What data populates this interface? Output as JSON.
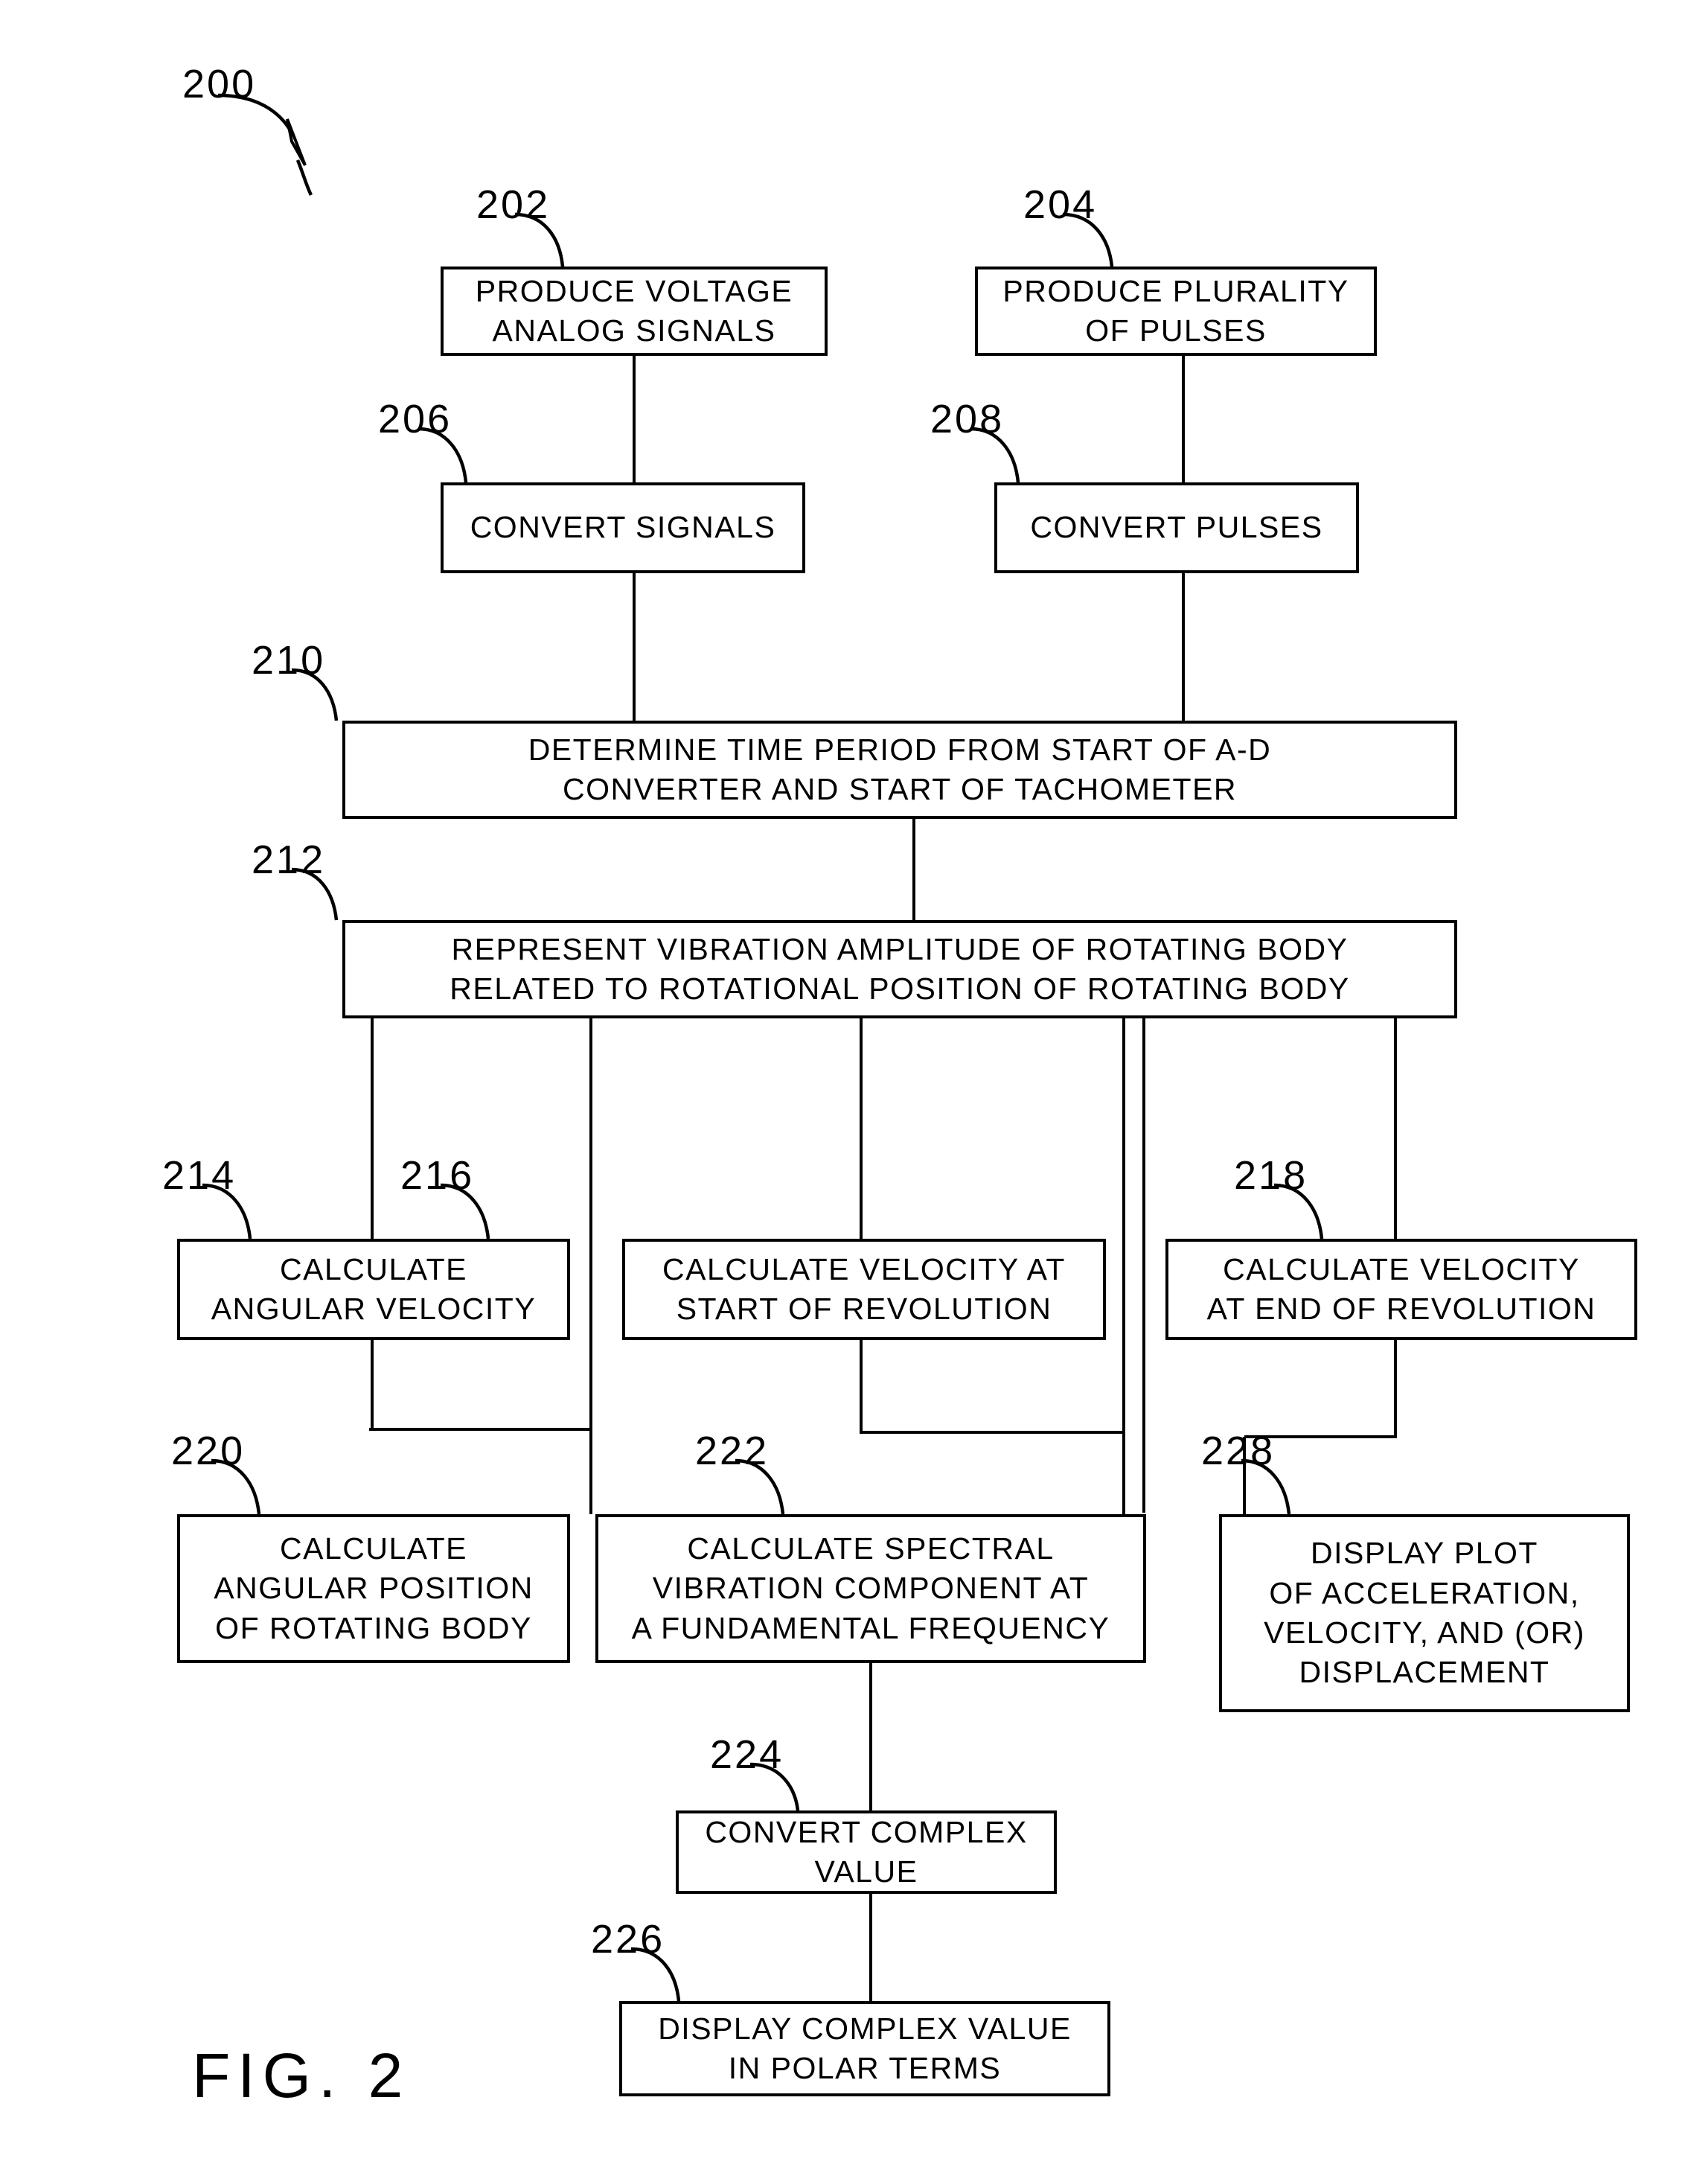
{
  "figure": {
    "caption": "FIG.  2",
    "diagram_ref": "200"
  },
  "nodes": [
    {
      "id": "202",
      "ref": "202",
      "lines": [
        "PRODUCE VOLTAGE",
        "ANALOG SIGNALS"
      ]
    },
    {
      "id": "204",
      "ref": "204",
      "lines": [
        "PRODUCE PLURALITY",
        "OF PULSES"
      ]
    },
    {
      "id": "206",
      "ref": "206",
      "lines": [
        "CONVERT SIGNALS"
      ]
    },
    {
      "id": "208",
      "ref": "208",
      "lines": [
        "CONVERT PULSES"
      ]
    },
    {
      "id": "210",
      "ref": "210",
      "lines": [
        "DETERMINE TIME PERIOD FROM START OF A-D",
        "CONVERTER AND START OF TACHOMETER"
      ]
    },
    {
      "id": "212",
      "ref": "212",
      "lines": [
        "REPRESENT VIBRATION AMPLITUDE OF ROTATING BODY",
        "RELATED TO ROTATIONAL POSITION OF ROTATING BODY"
      ]
    },
    {
      "id": "214",
      "ref": "214",
      "lines": [
        "CALCULATE",
        "ANGULAR VELOCITY"
      ]
    },
    {
      "id": "216",
      "ref": "216",
      "lines": [
        "CALCULATE VELOCITY AT",
        "START OF REVOLUTION"
      ]
    },
    {
      "id": "218",
      "ref": "218",
      "lines": [
        "CALCULATE VELOCITY",
        "AT END OF REVOLUTION"
      ]
    },
    {
      "id": "220",
      "ref": "220",
      "lines": [
        "CALCULATE",
        "ANGULAR POSITION",
        "OF ROTATING BODY"
      ]
    },
    {
      "id": "222",
      "ref": "222",
      "lines": [
        "CALCULATE SPECTRAL",
        "VIBRATION COMPONENT AT",
        "A FUNDAMENTAL FREQUENCY"
      ]
    },
    {
      "id": "228",
      "ref": "228",
      "lines": [
        "DISPLAY PLOT",
        "OF ACCELERATION,",
        "VELOCITY, AND (OR)",
        "DISPLACEMENT"
      ]
    },
    {
      "id": "224",
      "ref": "224",
      "lines": [
        "CONVERT COMPLEX",
        "VALUE"
      ]
    },
    {
      "id": "226",
      "ref": "226",
      "lines": [
        "DISPLAY COMPLEX VALUE",
        "IN POLAR TERMS"
      ]
    }
  ],
  "colors": {
    "ink": "#000000",
    "paper": "#ffffff"
  }
}
